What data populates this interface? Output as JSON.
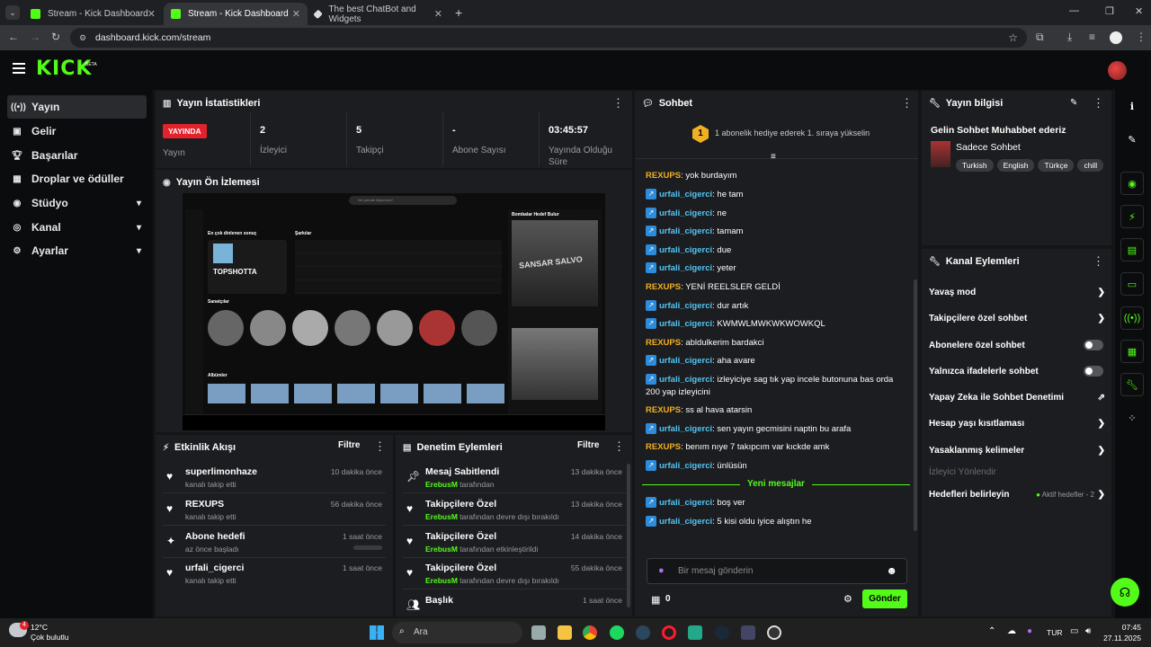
{
  "browser": {
    "tabs": [
      {
        "label": "Stream - Kick Dashboard"
      },
      {
        "label": "Stream - Kick Dashboard"
      },
      {
        "label": "The best ChatBot and Widgets"
      }
    ],
    "url": "dashboard.kick.com/stream"
  },
  "header": {
    "logo": "KICK",
    "beta": "BETA"
  },
  "sidebar": {
    "items": [
      {
        "label": "Yayın",
        "icon": "broadcast-icon"
      },
      {
        "label": "Gelir",
        "icon": "money-icon"
      },
      {
        "label": "Başarılar",
        "icon": "trophy-icon"
      },
      {
        "label": "Droplar ve ödüller",
        "icon": "gift-icon"
      },
      {
        "label": "Stüdyo",
        "icon": "studio-icon"
      },
      {
        "label": "Kanal",
        "icon": "channel-icon"
      },
      {
        "label": "Ayarlar",
        "icon": "gear-icon"
      }
    ]
  },
  "stats": {
    "title": "Yayın İstatistikleri",
    "live_badge": "YAYINDA",
    "live_label": "Yayın",
    "viewers": {
      "value": "2",
      "label": "İzleyici"
    },
    "followers": {
      "value": "5",
      "label": "Takipçi"
    },
    "subs": {
      "value": "-",
      "label": "Abone Sayısı"
    },
    "uptime": {
      "value": "03:45:57",
      "label": "Yayında Olduğu Süre"
    }
  },
  "preview": {
    "title": "Yayın Ön İzlemesi",
    "search_placeholder": "Ne çalmak istiyorsun?",
    "tops_title": "En çok dinlenen sonuç",
    "top_artist": "TOPSHOTTA",
    "songs_title": "Şarkılar",
    "artists_title": "Sanatçılar",
    "albums_title": "Albümler",
    "right_title": "Bombalar Hedef Bulur",
    "album_text": "SANSAR SALVO"
  },
  "activity": {
    "title": "Etkinlik Akışı",
    "filter": "Filtre",
    "items": [
      {
        "title": "superlimonhaze",
        "sub": "kanalı takip etti",
        "time": "10 dakika önce",
        "icon": "heart-icon"
      },
      {
        "title": "REXUPS",
        "sub": "kanalı takip etti",
        "time": "56 dakika önce",
        "icon": "heart-icon"
      },
      {
        "title": "Abone hedefi",
        "sub": "az önce başladı",
        "time": "1 saat önce",
        "icon": "sparkle-icon"
      },
      {
        "title": "urfali_cigerci",
        "sub": "kanalı takip etti",
        "time": "1 saat önce",
        "icon": "heart-icon"
      }
    ]
  },
  "moderation": {
    "title": "Denetim Eylemleri",
    "filter": "Filtre",
    "items": [
      {
        "title": "Mesaj Sabitlendi",
        "user": "ErebusM",
        "sub": "tarafından",
        "time": "13 dakika önce",
        "icon": "pin-icon"
      },
      {
        "title": "Takipçilere Özel",
        "user": "ErebusM",
        "sub": "tarafından devre dışı bırakıldı",
        "time": "13 dakika önce",
        "icon": "heart-icon"
      },
      {
        "title": "Takipçilere Özel",
        "user": "ErebusM",
        "sub": "tarafından etkinleştirildi",
        "time": "14 dakika önce",
        "icon": "heart-icon"
      },
      {
        "title": "Takipçilere Özel",
        "user": "ErebusM",
        "sub": "tarafından devre dışı bırakıldı",
        "time": "55 dakika önce",
        "icon": "heart-icon"
      },
      {
        "title": "Başlık",
        "user": "",
        "sub": "",
        "time": "1 saat önce",
        "icon": "users-icon"
      }
    ]
  },
  "chat": {
    "title": "Sohbet",
    "gift_banner": "1 abonelik hediye ederek 1. sıraya yükselin",
    "gift_rank": "1",
    "messages": [
      {
        "user": "REXUPS",
        "text": "yok burdayım",
        "type": "u2"
      },
      {
        "user": "urfali_cigerci",
        "text": "he tam",
        "type": "u1"
      },
      {
        "user": "urfali_cigerci",
        "text": "ne",
        "type": "u1"
      },
      {
        "user": "urfali_cigerci",
        "text": "tamam",
        "type": "u1"
      },
      {
        "user": "urfali_cigerci",
        "text": "due",
        "type": "u1"
      },
      {
        "user": "urfali_cigerci",
        "text": "yeter",
        "type": "u1"
      },
      {
        "user": "REXUPS",
        "text": "YENİ REELSLER GELDİ",
        "type": "u2"
      },
      {
        "user": "urfali_cigerci",
        "text": "dur artık",
        "type": "u1"
      },
      {
        "user": "urfali_cigerci",
        "text": "KWMWLMWKWKWOWKQL",
        "type": "u1"
      },
      {
        "user": "REXUPS",
        "text": "abldulkerim bardakci",
        "type": "u2"
      },
      {
        "user": "urfali_cigerci",
        "text": "aha avare",
        "type": "u1"
      },
      {
        "user": "urfali_cigerci",
        "text": "izleyiciye sag tık yap incele butonuna bas orda 200 yap izleyicini",
        "type": "u1"
      },
      {
        "user": "REXUPS",
        "text": "ss al hava atarsin",
        "type": "u2"
      },
      {
        "user": "urfali_cigerci",
        "text": "sen yayın gecmisini naptin bu arafa",
        "type": "u1"
      },
      {
        "user": "REXUPS",
        "text": "benım nıye 7 takıpcım var kıckde amk",
        "type": "u2"
      },
      {
        "user": "urfali_cigerci",
        "text": "ünlüsün",
        "type": "u1"
      }
    ],
    "new_messages": "Yeni mesajlar",
    "new": [
      {
        "user": "urfali_cigerci",
        "text": "boş ver",
        "type": "u1"
      },
      {
        "user": "urfali_cigerci",
        "text": "5 kisi oldu iyice alıştın he",
        "type": "u1"
      }
    ],
    "input_placeholder": "Bir mesaj gönderin",
    "points": "0",
    "send": "Gönder"
  },
  "info": {
    "title": "Yayın bilgisi",
    "stream_title": "Gelin Sohbet Muhabbet ederiz",
    "category": "Sadece Sohbet",
    "tags": [
      "Turkish",
      "English",
      "Türkçe",
      "chill"
    ]
  },
  "actions": {
    "title": "Kanal Eylemleri",
    "items": [
      {
        "label": "Yavaş mod",
        "control": "chevron"
      },
      {
        "label": "Takipçilere özel sohbet",
        "control": "chevron"
      },
      {
        "label": "Abonelere özel sohbet",
        "control": "toggle"
      },
      {
        "label": "Yalnızca ifadelerle sohbet",
        "control": "toggle"
      },
      {
        "label": "Yapay Zeka ile Sohbet Denetimi",
        "control": "external"
      },
      {
        "label": "Hesap yaşı kısıtlaması",
        "control": "chevron"
      },
      {
        "label": "Yasaklanmış kelimeler",
        "control": "chevron"
      },
      {
        "label": "İzleyici Yönlendir",
        "control": "none"
      },
      {
        "label": "Hedefleri belirleyin",
        "control": "chevron",
        "badge": "Aktif hedefler - 2"
      }
    ]
  },
  "taskbar": {
    "weather_temp": "12°C",
    "weather_text": "Çok bulutlu",
    "weather_badge": "4",
    "search": "Ara",
    "lang": "TUR",
    "time": "07:45",
    "date": "27.11.2025"
  },
  "colors": {
    "accent": "#53fc18",
    "live": "#e3232c",
    "panel": "#1c1d20",
    "user_blue": "#53c6f5",
    "user_gold": "#f0b024"
  }
}
